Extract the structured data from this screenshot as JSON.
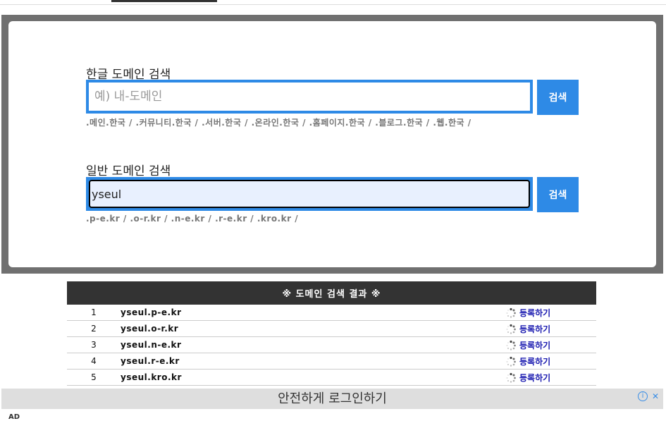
{
  "korean_search": {
    "label": "한글 도메인 검색",
    "placeholder": "예) 내-도메인",
    "value": "",
    "button": "검색",
    "hint": ".메인.한국 / .커뮤니티.한국 / .서버.한국 / .온라인.한국 / .홈페이지.한국 / .블로그.한국 / .웹.한국 /"
  },
  "general_search": {
    "label": "일반 도메인 검색",
    "placeholder": "",
    "value": "yseul",
    "button": "검색",
    "hint": ".p-e.kr / .o-r.kr / .n-e.kr / .r-e.kr / .kro.kr /"
  },
  "results": {
    "title": "※ 도메인 검색 결과 ※",
    "rows": [
      {
        "num": "1",
        "domain": "yseul.p-e.kr",
        "action": "등록하기"
      },
      {
        "num": "2",
        "domain": "yseul.o-r.kr",
        "action": "등록하기"
      },
      {
        "num": "3",
        "domain": "yseul.n-e.kr",
        "action": "등록하기"
      },
      {
        "num": "4",
        "domain": "yseul.r-e.kr",
        "action": "등록하기"
      },
      {
        "num": "5",
        "domain": "yseul.kro.kr",
        "action": "등록하기"
      }
    ]
  },
  "ad": {
    "title": "안전하게 로그인하기",
    "info": "i",
    "close": "✕",
    "label": "AD"
  },
  "colors": {
    "accent": "#2e8ae6",
    "panel_border": "#707070",
    "header": "#333333",
    "link": "#1a1ab0"
  }
}
